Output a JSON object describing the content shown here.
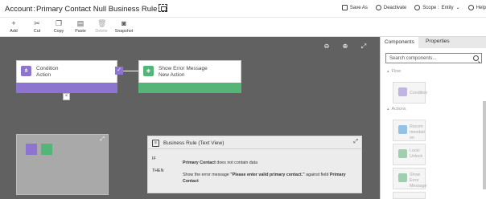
{
  "title": {
    "entity": "Account",
    "rule": "Primary Contact Null Business Rule"
  },
  "toolbar_right": {
    "save_as": "Save As",
    "deactivate": "Deactivate",
    "scope_label": "Scope :",
    "scope_value": "Entity",
    "help": "Help"
  },
  "commands": {
    "add": "Add",
    "cut": "Cut",
    "copy": "Copy",
    "paste": "Paste",
    "delete": "Delete",
    "snapshot": "Snapshot"
  },
  "nodes": {
    "condition": {
      "title": "Condition",
      "subtitle": "Action"
    },
    "error": {
      "title": "Show Error Message",
      "subtitle": "New Action"
    }
  },
  "text_view": {
    "title": "Business Rule (Text View)",
    "if_label": "IF",
    "then_label": "THEN",
    "if_field": "Primary Contact",
    "if_rest": " does not contain data",
    "then_pre": "Show the error message ",
    "then_msg": "\"Please enter  valid primary contact.\"",
    "then_mid": " against field ",
    "then_field": "Primary Contact"
  },
  "panel": {
    "tabs": [
      "Components",
      "Properties"
    ],
    "search_placeholder": "Search components...",
    "sections": {
      "flow": "Flow",
      "actions": "Actions"
    },
    "tiles": [
      "Condition",
      "Recommendation",
      "Lock/ Unlock",
      "Show Error Message"
    ]
  },
  "colors": {
    "condition": "#8c74cf",
    "action": "#55b478",
    "canvas": "#616161"
  }
}
